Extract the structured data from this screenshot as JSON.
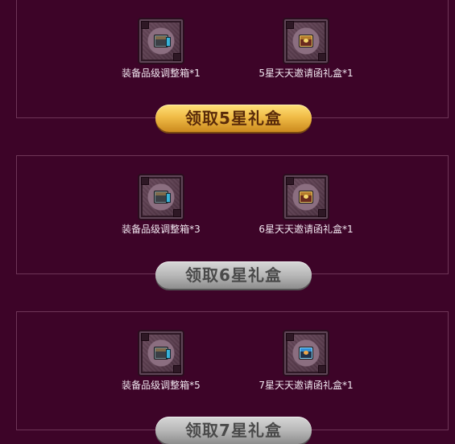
{
  "rewards": [
    {
      "items": [
        {
          "label": "装备品级调整箱*1",
          "icon": "chest-icon"
        },
        {
          "label": "5星天天邀请函礼盒*1",
          "icon": "giftbox-icon"
        }
      ],
      "button_label": "领取5星礼盒",
      "button_state": "active"
    },
    {
      "items": [
        {
          "label": "装备品级调整箱*3",
          "icon": "chest-icon"
        },
        {
          "label": "6星天天邀请函礼盒*1",
          "icon": "giftbox-icon"
        }
      ],
      "button_label": "领取6星礼盒",
      "button_state": "disabled"
    },
    {
      "items": [
        {
          "label": "装备品级调整箱*5",
          "icon": "chest-icon"
        },
        {
          "label": "7星天天邀请函礼盒*1",
          "icon": "giftbox-blue-icon"
        }
      ],
      "button_label": "领取7星礼盒",
      "button_state": "disabled"
    }
  ]
}
